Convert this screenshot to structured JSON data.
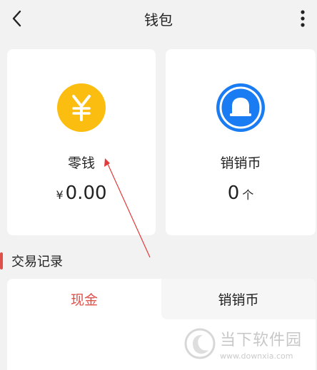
{
  "header": {
    "title": "钱包",
    "back_icon": "chevron-left-icon",
    "more_icon": "more-vertical-icon"
  },
  "cards": {
    "change": {
      "icon": "yen-coin-icon",
      "icon_color": "#fbbd0f",
      "label": "零钱",
      "currency": "¥",
      "amount": "0.00"
    },
    "coins": {
      "icon": "bell-icon",
      "icon_color": "#1a7cf2",
      "label": "销销币",
      "count": "0",
      "unit": "个"
    }
  },
  "records": {
    "title": "交易记录",
    "accent": "#e0504a"
  },
  "tabs": {
    "cash": "现金",
    "coins": "销销币"
  },
  "watermark": {
    "name": "当下软件园",
    "url": "www.downxia.com"
  }
}
